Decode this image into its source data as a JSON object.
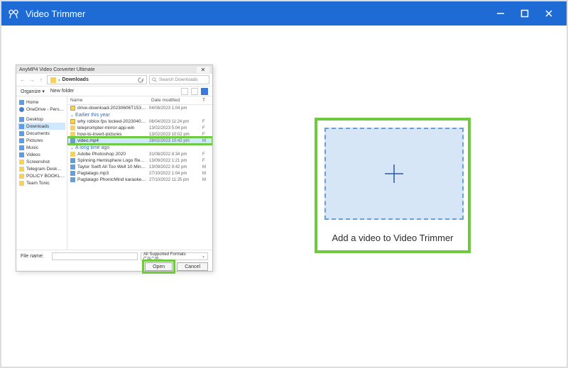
{
  "app": {
    "title": "Video Trimmer"
  },
  "drop": {
    "caption": "Add a video to Video Trimmer"
  },
  "dialog": {
    "title": "AnyMP4 Video Converter Ultimate",
    "breadcrumb": "Downloads",
    "search_placeholder": "Search Downloads",
    "toolbar_organize": "Organize ▾",
    "toolbar_newfolder": "New folder",
    "tree": [
      {
        "label": "Home",
        "iconClass": "ic-home"
      },
      {
        "label": "OneDrive - Pers…",
        "iconClass": "ic-cloud"
      },
      {
        "label": "Desktop",
        "iconClass": "ic-desk"
      },
      {
        "label": "Downloads",
        "iconClass": "ic-dl"
      },
      {
        "label": "Documents",
        "iconClass": "ic-doc"
      },
      {
        "label": "Pictures",
        "iconClass": "ic-pic"
      },
      {
        "label": "Music",
        "iconClass": "ic-mus"
      },
      {
        "label": "Videos",
        "iconClass": "ic-vid"
      },
      {
        "label": "Screenshot",
        "iconClass": "ic-fold"
      },
      {
        "label": "Telegram Desk…",
        "iconClass": "ic-fold"
      },
      {
        "label": "POLICY BOOKL…",
        "iconClass": "ic-fold"
      },
      {
        "label": "Team Tonic",
        "iconClass": "ic-fold"
      }
    ],
    "columns": {
      "name": "Name",
      "date": "Date modified",
      "type": "T"
    },
    "groups": {
      "today_item": {
        "name": "drive-download-20230606T153301AZ-001",
        "date": "04/08/2023 1:04 pm",
        "type": ""
      },
      "g1_label": "Earlier this year",
      "g1_items": [
        {
          "name": "why roblox fps locked-20230406T15241-…",
          "date": "06/04/2023 11:24 pm",
          "type": "F"
        },
        {
          "name": "teleprompter-mirror-app-win",
          "date": "13/02/2023 5:04 pm",
          "type": "F"
        },
        {
          "name": "how-to-invert-pictures",
          "date": "13/02/2023 10:02 pm",
          "type": "F"
        },
        {
          "name": "video.mp4",
          "date": "28/02/2023 10:42 pm",
          "type": "M"
        }
      ],
      "g2_label": "A long time ago",
      "g2_items": [
        {
          "name": "Adobe Photoshop 2020",
          "date": "31/08/2022 8:34 pm",
          "type": "F"
        },
        {
          "name": "Spinning Hemisphere Logo Reveal_free…",
          "date": "13/09/2022 1:21 pm",
          "type": "F"
        },
        {
          "name": "Taylor Swift  All Too Well 10 Minute Versi…",
          "date": "13/09/2022 9:42 pm",
          "type": "M"
        },
        {
          "name": "Pagtatago.mp3",
          "date": "27/10/2022 1:04 pm",
          "type": "M"
        },
        {
          "name": "Pagtatago PhonicMind karaoke preview.…",
          "date": "27/10/2022 11:25 pm",
          "type": "M"
        }
      ]
    },
    "filename_label": "File name:",
    "filter_label": "All Supported Formats (*.ts;*.m…",
    "open_btn": "Open",
    "cancel_btn": "Cancel"
  }
}
